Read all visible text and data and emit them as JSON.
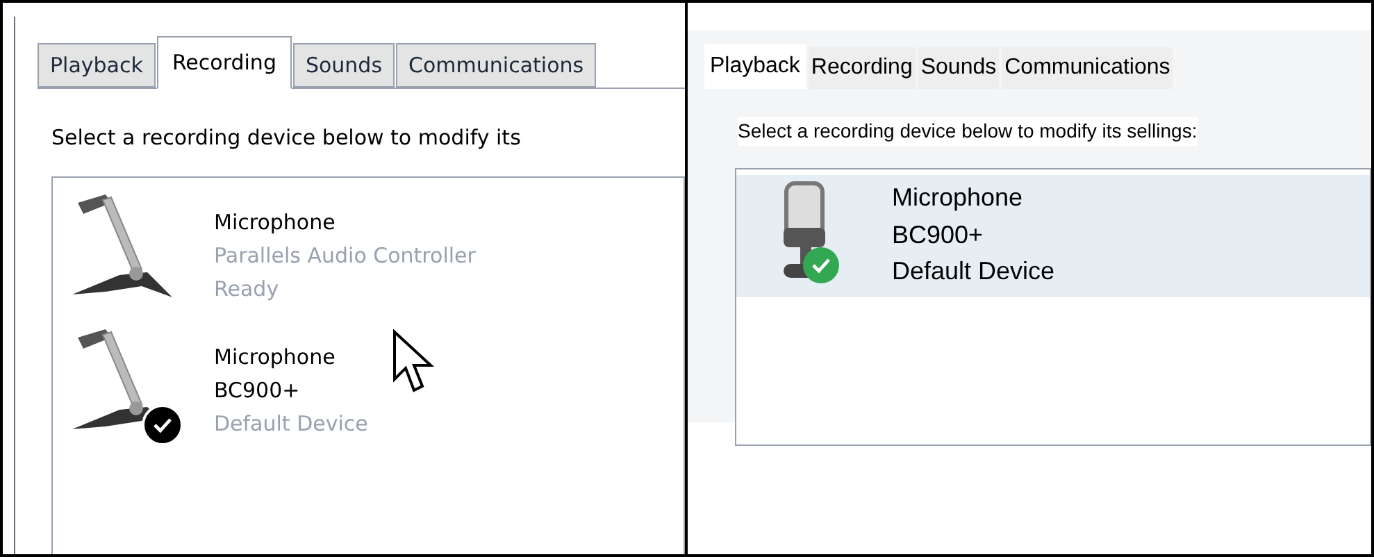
{
  "panels": [
    {
      "kind": "classic",
      "tabs": [
        {
          "label": "Playback",
          "selected": false
        },
        {
          "label": "Recording",
          "selected": true
        },
        {
          "label": "Sounds",
          "selected": false
        },
        {
          "label": "Communications",
          "selected": false
        }
      ],
      "instruction": "Select a recording device below to modify its",
      "devices": [
        {
          "name": "Microphone",
          "lines": [
            {
              "text": "Parallels Audio Controller",
              "dim": true
            },
            {
              "text": "Ready",
              "dim": true
            }
          ],
          "default": false,
          "selected": false,
          "cursor": false
        },
        {
          "name": "Microphone",
          "lines": [
            {
              "text": "BC900+",
              "dim": false
            },
            {
              "text": "Default Device",
              "dim": true
            }
          ],
          "default": true,
          "selected": false,
          "cursor": true
        }
      ]
    },
    {
      "kind": "modern",
      "tabs": [
        {
          "label": "Playback",
          "selected": true
        },
        {
          "label": "Recording",
          "selected": false
        },
        {
          "label": "Sounds",
          "selected": false
        },
        {
          "label": "Communications",
          "selected": false
        }
      ],
      "instruction": "Select a recording device below to modify its sellings:",
      "devices": [
        {
          "name": "Microphone",
          "lines": [
            {
              "text": "BC900+",
              "dim": false
            },
            {
              "text": "Default Device",
              "dim": false
            }
          ],
          "default": true,
          "selected": true,
          "cursor": false
        }
      ]
    }
  ]
}
